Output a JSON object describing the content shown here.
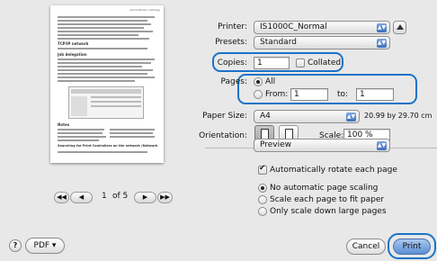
{
  "preview": {
    "header_text": "Administrator Settings",
    "section1_heading": "TCP/IP network",
    "section2_heading": "Job delegation",
    "notes_label": "Notes",
    "footer_heading": "Searching for Print Controllers on the network (Network PDF list from network)",
    "pager": {
      "first_icon": "◀◀",
      "prev_icon": "◀",
      "page": "1",
      "of_label": "of 5",
      "next_icon": "▶",
      "last_icon": "▶▶"
    }
  },
  "settings": {
    "printer_label": "Printer:",
    "printer_value": "IS1000C_Normal",
    "presets_label": "Presets:",
    "presets_value": "Standard",
    "copies_label": "Copies:",
    "copies_value": "1",
    "collated_label": "Collated",
    "pages_label": "Pages:",
    "all_label": "All",
    "from_label": "From:",
    "from_value": "1",
    "to_label": "to:",
    "to_value": "1",
    "paper_size_label": "Paper Size:",
    "paper_size_value": "A4",
    "paper_dims": "20.99 by 29.70 cm",
    "orientation_label": "Orientation:",
    "scale_label": "Scale:",
    "scale_value": "100 %",
    "section_value": "Preview",
    "auto_rotate_label": "Automatically rotate each page",
    "scaling_options": [
      "No automatic page scaling",
      "Scale each page to fit paper",
      "Only scale down large pages"
    ]
  },
  "footer": {
    "help_icon": "?",
    "pdf_label": "PDF ▾",
    "cancel_label": "Cancel",
    "print_label": "Print"
  },
  "colors": {
    "highlight": "#1a73c8",
    "accent": "#3d6fbd"
  }
}
